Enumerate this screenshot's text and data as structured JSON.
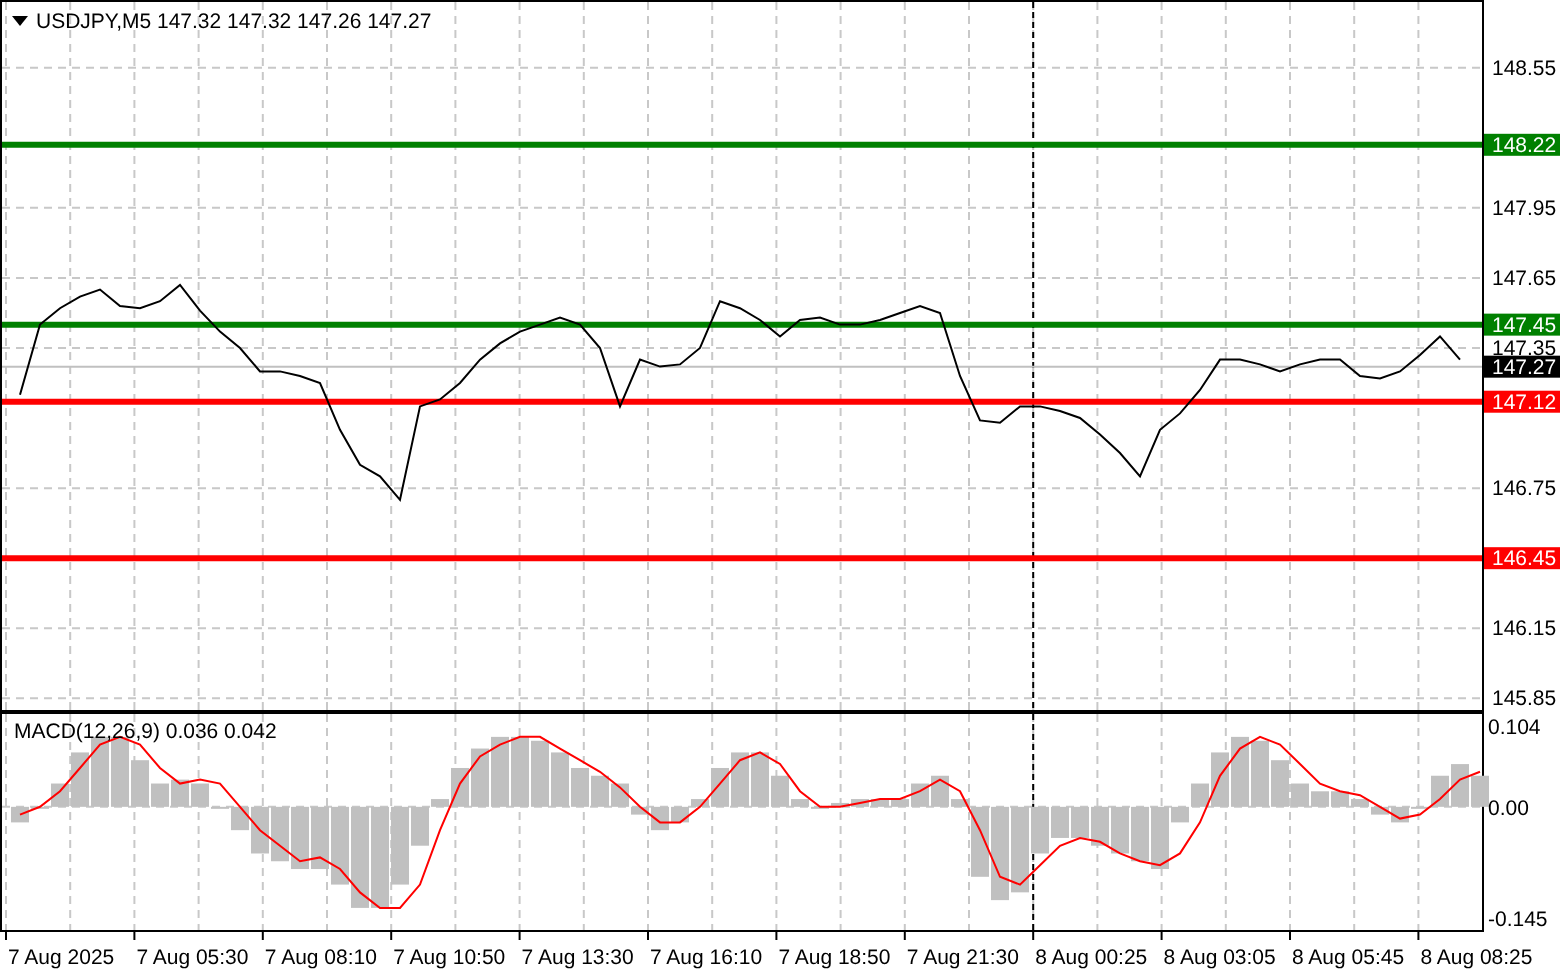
{
  "price_pane": {
    "title": "USDJPY,M5 147.32 147.32 147.26 147.27",
    "current_price": "147.27",
    "chart_data": {
      "type": "line",
      "grid": true,
      "series": [
        {
          "color": "#000000",
          "values": [
            147.15,
            147.45,
            147.52,
            147.57,
            147.6,
            147.53,
            147.52,
            147.55,
            147.62,
            147.51,
            147.42,
            147.35,
            147.25,
            147.25,
            147.23,
            147.2,
            147.0,
            146.85,
            146.8,
            146.7,
            147.1,
            147.13,
            147.2,
            147.3,
            147.37,
            147.42,
            147.45,
            147.48,
            147.45,
            147.35,
            147.1,
            147.3,
            147.27,
            147.28,
            147.35,
            147.55,
            147.52,
            147.47,
            147.4,
            147.47,
            147.48,
            147.45,
            147.45,
            147.47,
            147.5,
            147.53,
            147.5,
            147.23,
            147.04,
            147.03,
            147.1,
            147.1,
            147.08,
            147.05,
            146.98,
            146.9,
            146.8,
            147.0,
            147.07,
            147.17,
            147.3,
            147.3,
            147.28,
            147.25,
            147.28,
            147.3,
            147.3,
            147.23,
            147.22,
            147.25,
            147.32,
            147.4,
            147.3
          ]
        }
      ],
      "ref_lines": [
        {
          "axis": "y",
          "value": 148.22,
          "label": "148.22",
          "color": "#008000"
        },
        {
          "axis": "y",
          "value": 147.45,
          "label": "147.45",
          "color": "#008000"
        },
        {
          "axis": "y",
          "value": 147.27,
          "color": "#c0c0c0"
        },
        {
          "axis": "y",
          "value": 147.12,
          "label": "147.12",
          "color": "#ff0000"
        },
        {
          "axis": "y",
          "value": 146.45,
          "label": "146.45",
          "color": "#ff0000"
        }
      ],
      "ylim": [
        145.8,
        148.84
      ],
      "yticks": [
        {
          "value": 148.55,
          "label": "148.55"
        },
        {
          "value": 147.95,
          "label": "147.95"
        },
        {
          "value": 147.65,
          "label": "147.65"
        },
        {
          "value": 147.35,
          "label": "147.35"
        },
        {
          "value": 146.75,
          "label": "146.75"
        },
        {
          "value": 146.15,
          "label": "146.15"
        },
        {
          "value": 145.85,
          "label": "145.85"
        }
      ]
    }
  },
  "macd_pane": {
    "title": "MACD(12,26,9) 0.036 0.042",
    "chart_data": {
      "type": "bar",
      "grid": true,
      "series": [
        {
          "color": "#c0c0c0",
          "values": [
            -0.02,
            0.0,
            0.03,
            0.07,
            0.09,
            0.09,
            0.06,
            0.03,
            0.035,
            0.03,
            0.0,
            -0.03,
            -0.06,
            -0.07,
            -0.08,
            -0.08,
            -0.1,
            -0.13,
            -0.13,
            -0.1,
            -0.05,
            0.01,
            0.05,
            0.075,
            0.09,
            0.09,
            0.085,
            0.07,
            0.05,
            0.04,
            0.03,
            -0.01,
            -0.03,
            -0.02,
            0.01,
            0.05,
            0.07,
            0.07,
            0.04,
            0.01,
            0.0,
            0.005,
            0.01,
            0.01,
            0.01,
            0.03,
            0.04,
            0.01,
            -0.09,
            -0.12,
            -0.11,
            -0.06,
            -0.04,
            -0.04,
            -0.05,
            -0.06,
            -0.07,
            -0.08,
            -0.02,
            0.03,
            0.07,
            0.09,
            0.085,
            0.06,
            0.03,
            0.02,
            0.02,
            0.01,
            -0.01,
            -0.02,
            0.0,
            0.04,
            0.055,
            0.04
          ]
        },
        {
          "type": "line",
          "color": "#ff0000",
          "values": [
            -0.01,
            0.0,
            0.02,
            0.05,
            0.08,
            0.09,
            0.08,
            0.05,
            0.03,
            0.035,
            0.03,
            0.0,
            -0.03,
            -0.05,
            -0.07,
            -0.065,
            -0.08,
            -0.11,
            -0.13,
            -0.13,
            -0.1,
            -0.03,
            0.03,
            0.065,
            0.08,
            0.09,
            0.09,
            0.075,
            0.06,
            0.045,
            0.025,
            0.0,
            -0.02,
            -0.02,
            0.0,
            0.03,
            0.06,
            0.07,
            0.055,
            0.02,
            0.0,
            0.0,
            0.005,
            0.01,
            0.01,
            0.02,
            0.035,
            0.02,
            -0.03,
            -0.09,
            -0.1,
            -0.075,
            -0.05,
            -0.04,
            -0.045,
            -0.06,
            -0.07,
            -0.075,
            -0.06,
            -0.02,
            0.04,
            0.075,
            0.09,
            0.08,
            0.055,
            0.03,
            0.02,
            0.015,
            0.0,
            -0.015,
            -0.01,
            0.01,
            0.035,
            0.045
          ]
        }
      ],
      "ylim": [
        -0.161,
        0.122
      ],
      "yticks": [
        {
          "value": 0.104,
          "label": "0.104"
        },
        {
          "value": 0,
          "label": "0.00"
        },
        {
          "value": -0.145,
          "label": "-0.145"
        }
      ]
    }
  },
  "time_axis": {
    "xticks": [
      {
        "label": "7 Aug 2025",
        "separator": false
      },
      {
        "label": "7 Aug 05:30",
        "separator": false
      },
      {
        "label": "7 Aug 08:10",
        "separator": false
      },
      {
        "label": "7 Aug 10:50",
        "separator": false
      },
      {
        "label": "7 Aug 13:30",
        "separator": false
      },
      {
        "label": "7 Aug 16:10",
        "separator": false
      },
      {
        "label": "7 Aug 18:50",
        "separator": false
      },
      {
        "label": "7 Aug 21:30",
        "separator": false
      },
      {
        "label": "8 Aug 00:25",
        "separator": true
      },
      {
        "label": "8 Aug 03:05",
        "separator": false
      },
      {
        "label": "8 Aug 05:45",
        "separator": false
      },
      {
        "label": "8 Aug 08:25",
        "separator": false
      }
    ]
  }
}
